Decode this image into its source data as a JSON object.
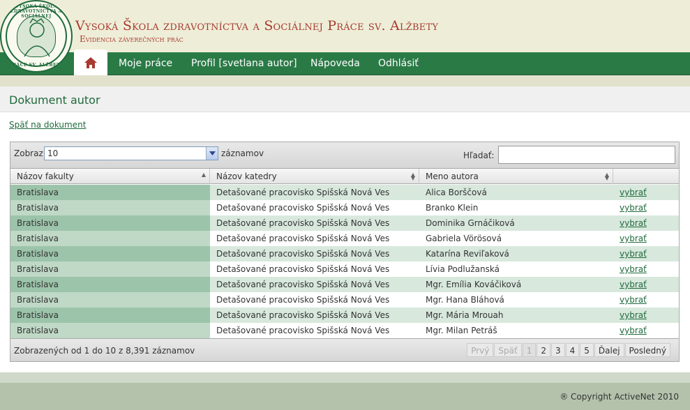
{
  "header": {
    "title": "Vysoká Škola zdravotníctva a Sociálnej  Práce sv. Alžbety",
    "subtitle": "Evidencia záverečných prác",
    "logo_text_top": "VYSOKÁ ŠKOLA ZDRAVOTNÍCTVA A SOCIÁLNEJ",
    "logo_text_bottom": "PRÁCE SV. ALŽBETY"
  },
  "nav": {
    "home_icon": "home-icon",
    "items": [
      "Moje práce",
      "Profil [svetlana autor]",
      "Nápoveda",
      "Odhlásiť"
    ]
  },
  "page": {
    "title": "Dokument autor",
    "back_link": "Späť na dokument"
  },
  "table": {
    "show_label": "Zobraz",
    "page_size": "10",
    "records_label": "záznamov",
    "search_label": "Hľadať:",
    "search_value": "",
    "columns": [
      "Názov fakulty",
      "Názov katedry",
      "Meno autora",
      ""
    ],
    "rows": [
      [
        "Bratislava",
        "Detašované pracovisko Spišská Nová Ves",
        "Alica Borščová",
        "vybrať"
      ],
      [
        "Bratislava",
        "Detašované pracovisko Spišská Nová Ves",
        "Branko Klein",
        "vybrať"
      ],
      [
        "Bratislava",
        "Detašované pracovisko Spišská Nová Ves",
        "Dominika Grnáčiková",
        "vybrať"
      ],
      [
        "Bratislava",
        "Detašované pracovisko Spišská Nová Ves",
        "Gabriela Vörösová",
        "vybrať"
      ],
      [
        "Bratislava",
        "Detašované pracovisko Spišská Nová Ves",
        "Katarína Reviľaková",
        "vybrať"
      ],
      [
        "Bratislava",
        "Detašované pracovisko Spišská Nová Ves",
        "Lívia Podlužanská",
        "vybrať"
      ],
      [
        "Bratislava",
        "Detašované pracovisko Spišská Nová Ves",
        "Mgr. Emília Kováčiková",
        "vybrať"
      ],
      [
        "Bratislava",
        "Detašované pracovisko Spišská Nová Ves",
        "Mgr. Hana Bláhová",
        "vybrať"
      ],
      [
        "Bratislava",
        "Detašované pracovisko Spišská Nová Ves",
        "Mgr. Mária Mrouah",
        "vybrať"
      ],
      [
        "Bratislava",
        "Detašované pracovisko Spišská Nová Ves",
        "Mgr. Milan Petráš",
        "vybrať"
      ]
    ],
    "info": "Zobrazených od 1 do 10 z 8,391 záznamov",
    "pager": {
      "first": "Prvý",
      "prev": "Späť",
      "pages": [
        "1",
        "2",
        "3",
        "4",
        "5"
      ],
      "next": "Ďalej",
      "last": "Posledný"
    }
  },
  "footer": {
    "copyright": "® Copyright ActiveNet 2010"
  },
  "colors": {
    "brand_green": "#2a7a46",
    "title_red": "#a83a30",
    "row_odd": "#d8e8dd"
  }
}
